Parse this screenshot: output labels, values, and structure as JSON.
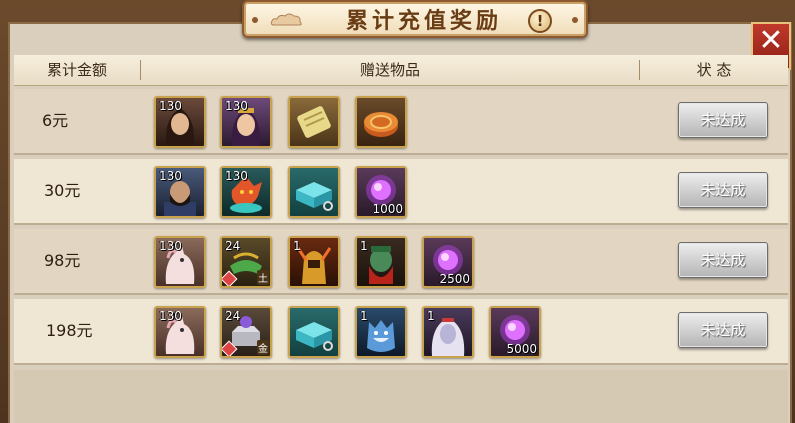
{
  "title": "累计充值奖励",
  "info_glyph": "!",
  "close_glyph": "✕",
  "header": {
    "amount": "累计金额",
    "items": "赠送物品",
    "status": "状 态"
  },
  "rows": [
    {
      "amount": "6元",
      "status": "未达成",
      "items": [
        {
          "icon": "hero-portrait-woman",
          "level": "130",
          "qty": "",
          "tag": ""
        },
        {
          "icon": "hero-portrait-princess",
          "level": "130",
          "qty": "",
          "tag": ""
        },
        {
          "icon": "scroll",
          "level": "",
          "qty": "",
          "tag": ""
        },
        {
          "icon": "mooncake",
          "level": "",
          "qty": "",
          "tag": ""
        }
      ]
    },
    {
      "amount": "30元",
      "status": "未达成",
      "items": [
        {
          "icon": "hero-portrait-general",
          "level": "130",
          "qty": "",
          "tag": ""
        },
        {
          "icon": "fire-beast",
          "level": "130",
          "qty": "",
          "tag": ""
        },
        {
          "icon": "gift-box",
          "level": "",
          "qty": "",
          "tag": ""
        },
        {
          "icon": "purple-orb",
          "level": "",
          "qty": "1000",
          "tag": ""
        }
      ]
    },
    {
      "amount": "98元",
      "status": "未达成",
      "items": [
        {
          "icon": "white-horse",
          "level": "130",
          "qty": "",
          "tag": ""
        },
        {
          "icon": "green-treasure",
          "level": "24",
          "qty": "",
          "tag": "土"
        },
        {
          "icon": "golden-warrior",
          "level": "1",
          "qty": "",
          "tag": ""
        },
        {
          "icon": "green-face-general",
          "level": "1",
          "qty": "",
          "tag": ""
        },
        {
          "icon": "purple-orb",
          "level": "",
          "qty": "2500",
          "tag": ""
        }
      ]
    },
    {
      "amount": "198元",
      "status": "未达成",
      "items": [
        {
          "icon": "white-horse",
          "level": "130",
          "qty": "",
          "tag": ""
        },
        {
          "icon": "silver-treasure",
          "level": "24",
          "qty": "",
          "tag": "金"
        },
        {
          "icon": "gift-box",
          "level": "",
          "qty": "",
          "tag": ""
        },
        {
          "icon": "blue-wolf",
          "level": "1",
          "qty": "",
          "tag": ""
        },
        {
          "icon": "white-hair-lady",
          "level": "1",
          "qty": "",
          "tag": ""
        },
        {
          "icon": "purple-orb",
          "level": "",
          "qty": "5000",
          "tag": ""
        }
      ]
    }
  ]
}
